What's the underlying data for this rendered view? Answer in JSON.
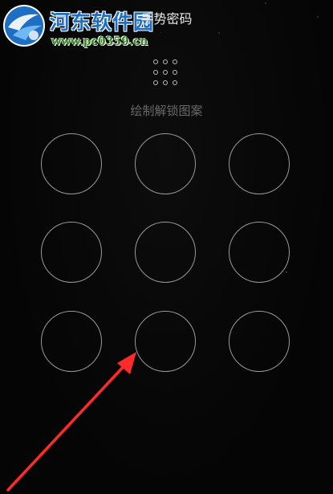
{
  "watermark": {
    "title": "河东软件园",
    "url": "www.pc0359.cn"
  },
  "header": {
    "title": "手势密码"
  },
  "hint": "绘制解锁图案",
  "grid": {
    "rows": 3,
    "cols": 3
  },
  "colors": {
    "node_stroke": "#9a9a9a",
    "hint_text": "#6a6a6a",
    "arrow": "#ff2a2a",
    "watermark_blue": "#1e6fc4",
    "watermark_green": "#2e8b1e"
  }
}
